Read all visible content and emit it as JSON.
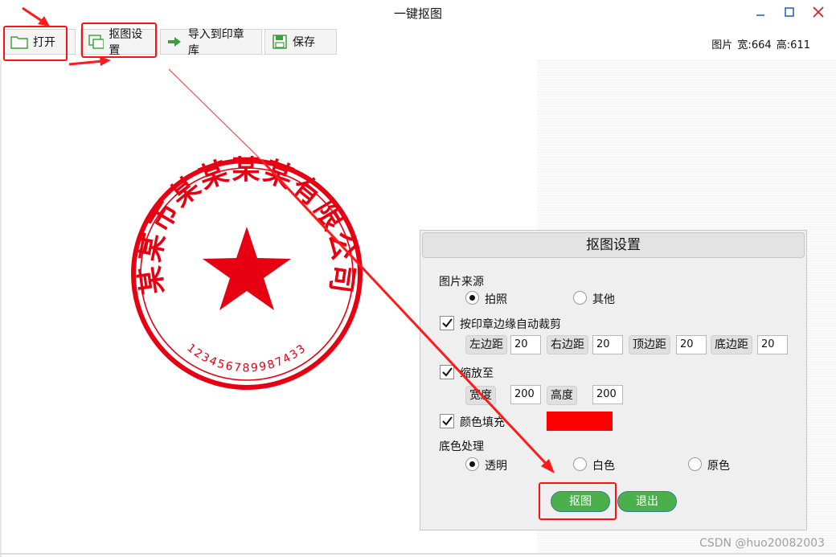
{
  "window": {
    "title": "一键抠图"
  },
  "toolbar": {
    "open_label": "打开",
    "settings_label": "抠图设置",
    "import_label": "导入到印章库",
    "save_label": "保存"
  },
  "image_info": {
    "label": "图片",
    "width_label": "宽:",
    "width": "664",
    "height_label": "高:",
    "height": "611"
  },
  "seal": {
    "company_text": "某某市某某某某有限公司",
    "serial_text": "123456789987433",
    "color": "#e60012"
  },
  "dialog": {
    "title": "抠图设置",
    "source_label": "图片来源",
    "source_options": [
      "拍照",
      "其他"
    ],
    "source_selected": "拍照",
    "autocrop_label": "按印章边缘自动裁剪",
    "autocrop_checked": true,
    "margins": [
      {
        "label": "左边距",
        "value": "20"
      },
      {
        "label": "右边距",
        "value": "20"
      },
      {
        "label": "顶边距",
        "value": "20"
      },
      {
        "label": "底边距",
        "value": "20"
      }
    ],
    "scale_label": "缩放至",
    "scale_checked": true,
    "width_label": "宽度",
    "width_value": "200",
    "height_label": "高度",
    "height_value": "200",
    "fill_label": "颜色填充",
    "fill_checked": true,
    "fill_color": "#ff0000",
    "bg_label": "底色处理",
    "bg_options": [
      "透明",
      "白色",
      "原色"
    ],
    "bg_selected": "透明",
    "cutout_button": "抠图",
    "exit_button": "退出"
  },
  "colors": {
    "annotation": "#ff1a1a",
    "button_green": "#4bb04b"
  },
  "watermark": "CSDN @huo20082003"
}
